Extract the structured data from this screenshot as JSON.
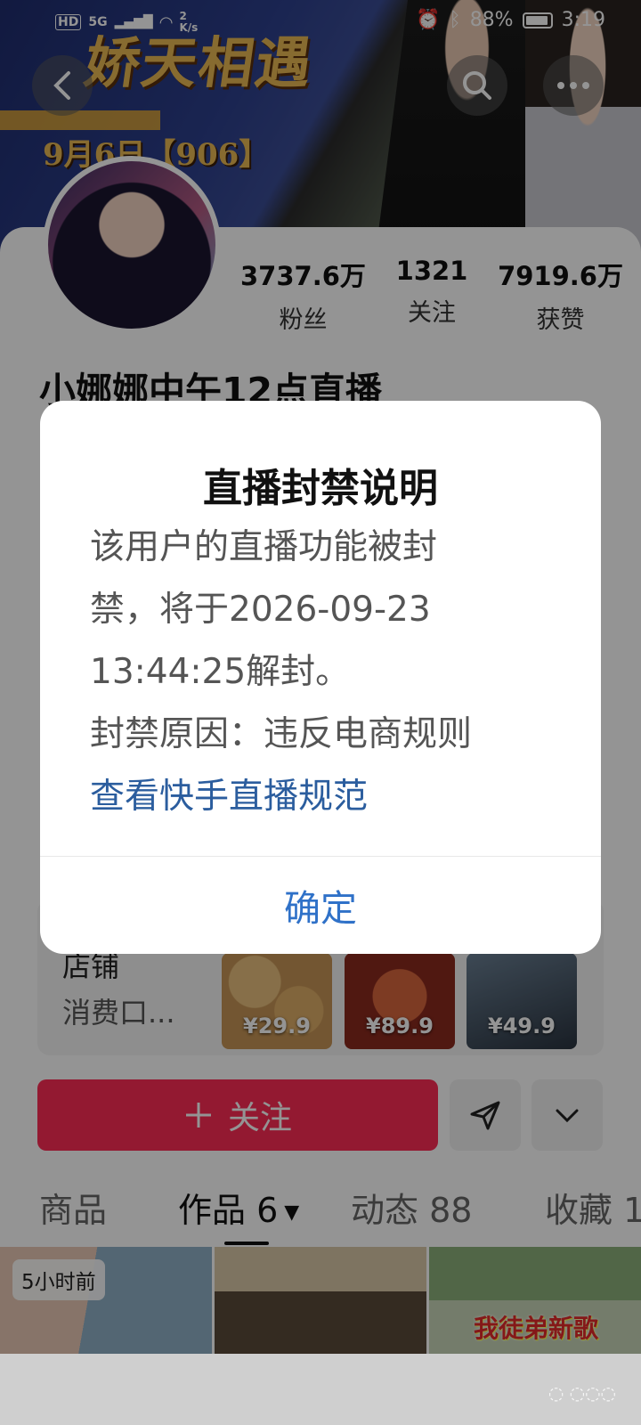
{
  "status_bar": {
    "hd": "HD",
    "network": "5G",
    "speed": "2 K/s",
    "battery": "88%",
    "time": "3:19"
  },
  "banner": {
    "title": "娇天相遇",
    "date": "9月6日【906】"
  },
  "profile": {
    "stats": [
      {
        "value": "3737.6万",
        "label": "粉丝"
      },
      {
        "value": "1321",
        "label": "关注"
      },
      {
        "value": "7919.6万",
        "label": "获赞"
      }
    ],
    "username": "小娜娜中午12点直播"
  },
  "store": {
    "title": "店铺",
    "subtitle": "消费口...",
    "products": [
      {
        "price": "¥29.9",
        "color": "#c79556"
      },
      {
        "price": "¥89.9",
        "color": "#b8452f"
      },
      {
        "price": "¥49.9",
        "color": "#3d4a57"
      }
    ]
  },
  "actions": {
    "follow_label": "关注"
  },
  "tabs": [
    {
      "label": "商品"
    },
    {
      "label": "作品 6"
    },
    {
      "label": "动态 88"
    },
    {
      "label": "收藏 1"
    }
  ],
  "works": [
    {
      "badge": "5小时前",
      "caption": ""
    },
    {
      "badge": "",
      "caption": ""
    },
    {
      "badge": "",
      "caption": "我徒弟新歌"
    }
  ],
  "modal": {
    "title": "直播封禁说明",
    "lines": [
      "该用户的直播功能被封",
      "禁，将于2026-09-23",
      "13:44:25解封。",
      "封禁原因：违反电商规则"
    ],
    "link": "查看快手直播规范",
    "confirm": "确定"
  },
  "colors": {
    "follow_button": "#fe2c55",
    "link": "#2b5d9e",
    "confirm": "#2f71c8"
  }
}
